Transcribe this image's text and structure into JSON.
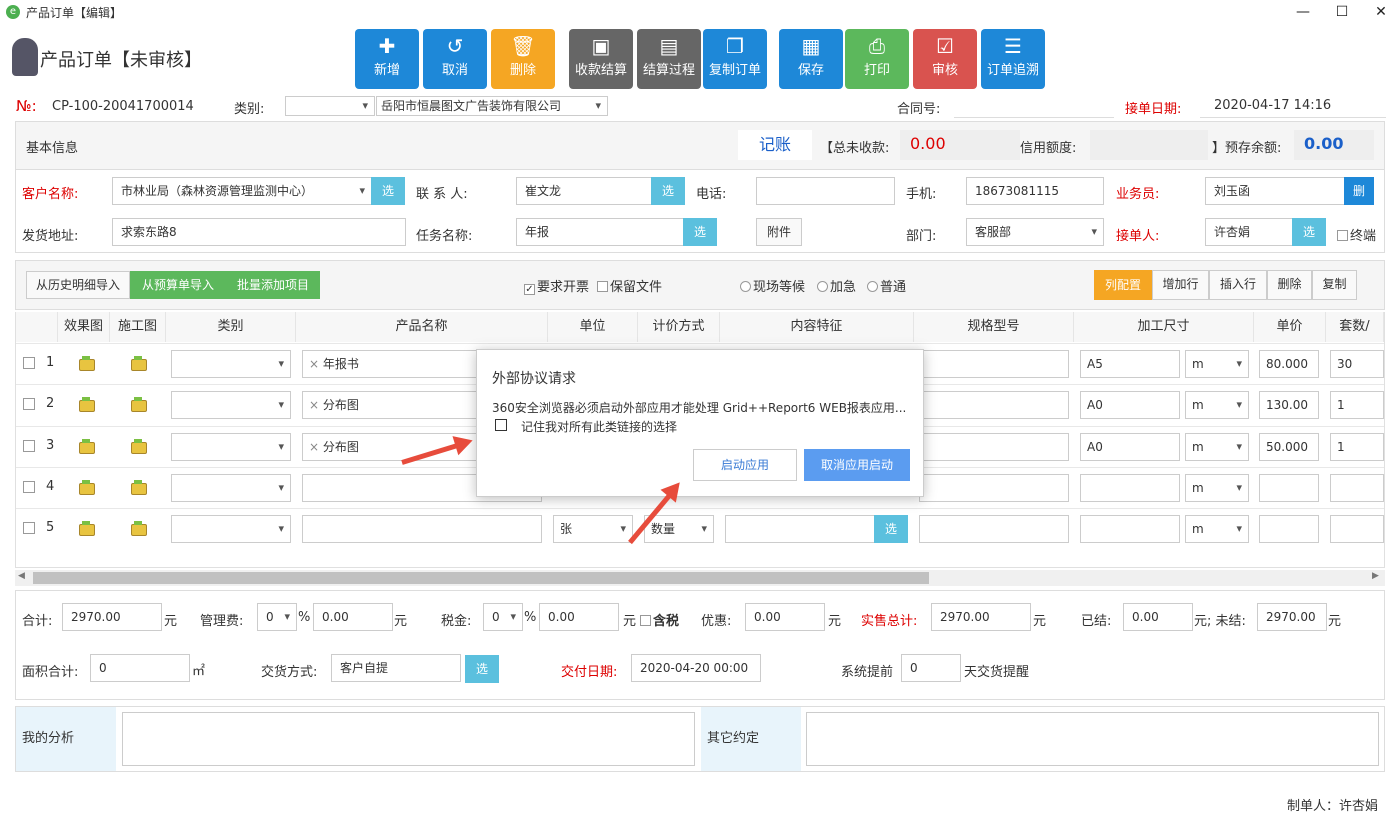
{
  "window": {
    "title": "产品订单【编辑】"
  },
  "header": {
    "title": "产品订单【未审核】"
  },
  "toolbar": [
    {
      "label": "新增",
      "icon": "plus-circle-icon",
      "glyph": "✚",
      "color": "blue"
    },
    {
      "label": "取消",
      "icon": "undo-icon",
      "glyph": "↺",
      "color": "blue"
    },
    {
      "label": "删除",
      "icon": "trash-icon",
      "glyph": "🗑",
      "color": "orange"
    },
    {
      "label": "收款结算",
      "icon": "money-icon",
      "glyph": "▣",
      "color": "gray"
    },
    {
      "label": "结算过程",
      "icon": "document-icon",
      "glyph": "▤",
      "color": "gray"
    },
    {
      "label": "复制订单",
      "icon": "copy-icon",
      "glyph": "❐",
      "color": "blue"
    },
    {
      "label": "保存",
      "icon": "save-icon",
      "glyph": "▦",
      "color": "blue"
    },
    {
      "label": "打印",
      "icon": "printer-icon",
      "glyph": "⎙",
      "color": "green"
    },
    {
      "label": "审核",
      "icon": "check-square-icon",
      "glyph": "☑",
      "color": "red"
    },
    {
      "label": "订单追溯",
      "icon": "server-icon",
      "glyph": "☰",
      "color": "blue"
    }
  ],
  "order": {
    "no_label": "№:",
    "no": "CP-100-20041700014",
    "type_label": "类别:",
    "company": "岳阳市恒晨图文广告装饰有限公司",
    "contract_label": "合同号:",
    "receive_date_label": "接单日期:",
    "receive_date": "2020-04-17 14:16"
  },
  "basic": {
    "title": "基本信息",
    "bookkeeping": "记账",
    "total_unpaid_label": "【总未收款:",
    "total_unpaid": "0.00",
    "credit_label": "信用额度:",
    "prepaid_label": "】预存余额:",
    "prepaid": "0.00"
  },
  "customer": {
    "name_label": "客户名称:",
    "name": "市林业局（森林资源管理监测中心）",
    "contact_label": "联 系 人:",
    "contact": "崔文龙",
    "phone_label": "电话:",
    "mobile_label": "手机:",
    "mobile": "18673081115",
    "sales_label": "业务员:",
    "sales": "刘玉函",
    "address_label": "发货地址:",
    "address": "求索东路8",
    "task_label": "任务名称:",
    "task": "年报",
    "attach_btn": "附件",
    "dept_label": "部门:",
    "dept": "客服部",
    "receiver_label": "接单人:",
    "receiver": "许杏娟",
    "end_label": "终端"
  },
  "buttons": {
    "select": "选",
    "delete_short": "删"
  },
  "grid_toolbar": {
    "import_history": "从历史明细导入",
    "import_budget": "从预算单导入",
    "batch_add": "批量添加项目",
    "invoice": "要求开票",
    "keep_file": "保留文件",
    "onsite": "现场等候",
    "urgent": "加急",
    "normal": "普通",
    "col_config": "列配置",
    "add_row": "增加行",
    "insert_row": "插入行",
    "delete": "删除",
    "copy": "复制"
  },
  "grid": {
    "headers": [
      "效果图",
      "施工图",
      "类别",
      "产品名称",
      "单位",
      "计价方式",
      "内容特征",
      "规格型号",
      "加工尺寸",
      "单价",
      "套数/"
    ],
    "rows": [
      {
        "no": "1",
        "product": "年报书",
        "size": "A5",
        "unit2": "m",
        "price": "80.000",
        "sets": "30"
      },
      {
        "no": "2",
        "product": "分布图",
        "size": "A0",
        "unit2": "m",
        "price": "130.00",
        "sets": "1"
      },
      {
        "no": "3",
        "product": "分布图",
        "size": "A0",
        "unit2": "m",
        "price": "50.000",
        "sets": "1"
      },
      {
        "no": "4",
        "product": "",
        "size": "",
        "unit2": "m",
        "price": "",
        "sets": ""
      },
      {
        "no": "5",
        "product": "",
        "size": "",
        "unit2": "m",
        "price": "",
        "sets": "",
        "unit": "张",
        "pricing": "数量"
      }
    ]
  },
  "totals": {
    "sum_label": "合计:",
    "sum": "2970.00",
    "yuan": "元",
    "mgmt_label": "管理费:",
    "mgmt_rate": "0",
    "pct": "%",
    "mgmt": "0.00",
    "tax_label": "税金:",
    "tax_rate": "0",
    "tax": "0.00",
    "tax_incl": "含税",
    "discount_label": "优惠:",
    "discount": "0.00",
    "actual_label": "实售总计:",
    "actual": "2970.00",
    "settled_label": "已结:",
    "settled": "0.00",
    "unsettled_label": "元; 未结:",
    "unsettled": "2970.00",
    "area_label": "面积合计:",
    "area": "0",
    "area_unit": "㎡",
    "delivery_label": "交货方式:",
    "delivery": "客户自提",
    "due_label": "交付日期:",
    "due": "2020-04-20 00:00",
    "remind_label": "系统提前",
    "remind": "0",
    "remind_suffix": "天交货提醒"
  },
  "notes": {
    "analysis_label": "我的分析",
    "other_label": "其它约定"
  },
  "footer": {
    "maker": "制单人：许杏娟"
  },
  "dialog": {
    "title": "外部协议请求",
    "message": "360安全浏览器必须启动外部应用才能处理 Grid++Report6 WEB报表应用...",
    "remember": "记住我对所有此类链接的选择",
    "launch": "启动应用",
    "cancel": "取消应用启动"
  },
  "colors": {
    "accent": "#1e88d8",
    "orange": "#f5a623",
    "green": "#5cb85c",
    "red": "#d9534f",
    "info": "#5bc0de"
  }
}
